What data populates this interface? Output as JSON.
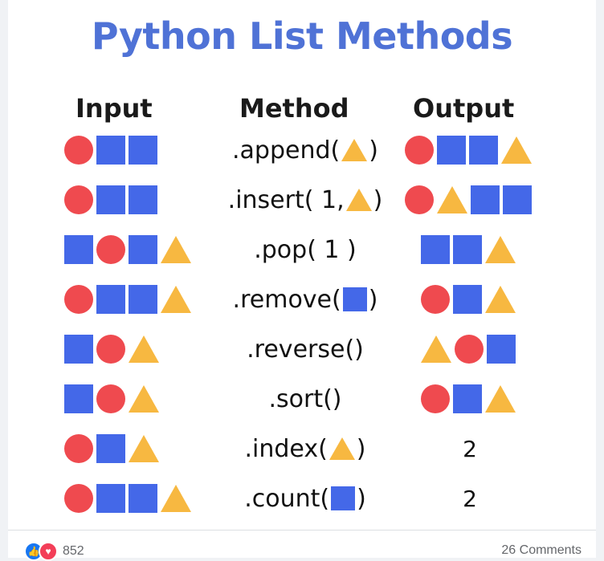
{
  "title": "Python List Methods",
  "headers": {
    "input": "Input",
    "method": "Method",
    "output": "Output"
  },
  "colors": {
    "title": "#4f72d6",
    "circle": "#ef4a4f",
    "square": "#4468e8",
    "triangle": "#f7b841",
    "like": "#1877f2",
    "love": "#f33e58"
  },
  "rows": [
    {
      "input": [
        "circle",
        "square",
        "square"
      ],
      "method_prefix": ".append(",
      "method_arg": "triangle",
      "method_suffix": ")",
      "output": [
        "circle",
        "square",
        "square",
        "triangle"
      ],
      "output_text": ""
    },
    {
      "input": [
        "circle",
        "square",
        "square"
      ],
      "method_prefix": ".insert( 1, ",
      "method_arg": "triangle",
      "method_suffix": ")",
      "output": [
        "circle",
        "triangle",
        "square",
        "square"
      ],
      "output_text": ""
    },
    {
      "input": [
        "square",
        "circle",
        "square",
        "triangle"
      ],
      "method_prefix": ".pop( 1 )",
      "method_arg": "",
      "method_suffix": "",
      "output": [
        "square",
        "square",
        "triangle"
      ],
      "output_text": ""
    },
    {
      "input": [
        "circle",
        "square",
        "square",
        "triangle"
      ],
      "method_prefix": ".remove(",
      "method_arg": "square",
      "method_suffix": ")",
      "output": [
        "circle",
        "square",
        "triangle"
      ],
      "output_text": ""
    },
    {
      "input": [
        "square",
        "circle",
        "triangle"
      ],
      "method_prefix": ".reverse()",
      "method_arg": "",
      "method_suffix": "",
      "output": [
        "triangle",
        "circle",
        "square"
      ],
      "output_text": ""
    },
    {
      "input": [
        "square",
        "circle",
        "triangle"
      ],
      "method_prefix": ".sort()",
      "method_arg": "",
      "method_suffix": "",
      "output": [
        "circle",
        "square",
        "triangle"
      ],
      "output_text": ""
    },
    {
      "input": [
        "circle",
        "square",
        "triangle"
      ],
      "method_prefix": ".index(",
      "method_arg": "triangle",
      "method_suffix": ")",
      "output": [],
      "output_text": "2"
    },
    {
      "input": [
        "circle",
        "square",
        "square",
        "triangle"
      ],
      "method_prefix": ".count(",
      "method_arg": "square",
      "method_suffix": ")",
      "output": [],
      "output_text": "2"
    }
  ],
  "footer": {
    "reaction_icons": [
      "like-icon",
      "love-icon"
    ],
    "reaction_count": "852",
    "comments_label": "26 Comments"
  }
}
